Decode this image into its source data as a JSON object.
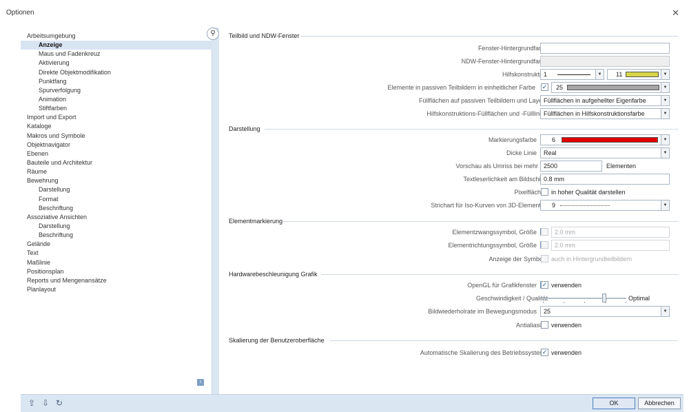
{
  "window": {
    "title": "Optionen"
  },
  "sidebar": {
    "items": [
      {
        "label": "Arbeitsumgebung",
        "level": 1
      },
      {
        "label": "Anzeige",
        "level": 2,
        "selected": true
      },
      {
        "label": "Maus und Fadenkreuz",
        "level": 2
      },
      {
        "label": "Aktivierung",
        "level": 2
      },
      {
        "label": "Direkte Objektmodifikation",
        "level": 2
      },
      {
        "label": "Punktfang",
        "level": 2
      },
      {
        "label": "Spurverfolgung",
        "level": 2
      },
      {
        "label": "Animation",
        "level": 2
      },
      {
        "label": "Stiftfarben",
        "level": 2
      },
      {
        "label": "Import und Export",
        "level": 1
      },
      {
        "label": "Kataloge",
        "level": 1
      },
      {
        "label": "Makros und Symbole",
        "level": 1
      },
      {
        "label": "Objektnavigator",
        "level": 1
      },
      {
        "label": "Ebenen",
        "level": 1
      },
      {
        "label": "Bauteile und Architektur",
        "level": 1
      },
      {
        "label": "Räume",
        "level": 1
      },
      {
        "label": "Bewehrung",
        "level": 1
      },
      {
        "label": "Darstellung",
        "level": 2
      },
      {
        "label": "Format",
        "level": 2
      },
      {
        "label": "Beschriftung",
        "level": 2
      },
      {
        "label": "Assoziative Ansichten",
        "level": 1
      },
      {
        "label": "Darstellung",
        "level": 2
      },
      {
        "label": "Beschriftung",
        "level": 2
      },
      {
        "label": "Gelände",
        "level": 1
      },
      {
        "label": "Text",
        "level": 1
      },
      {
        "label": "Maßlinie",
        "level": 1
      },
      {
        "label": "Positionsplan",
        "level": 1
      },
      {
        "label": "Reports und Mengenansätze",
        "level": 1
      },
      {
        "label": "Planlayout",
        "level": 1
      }
    ],
    "info_icon": "i"
  },
  "sections": {
    "teilbild": "Teilbild und NDW-Fenster",
    "darstellung": "Darstellung",
    "elementmarkierung": "Elementmarkierung",
    "hardware": "Hardwarebeschleunigung Grafik",
    "skalierung": "Skalierung der Benutzeroberfläche"
  },
  "teilbild": {
    "fenster_label": "Fenster-Hintergrundfarbe",
    "ndw_label": "NDW-Fenster-Hintergrundfarbe",
    "hilfs_label": "Hilfskonstruktion",
    "hilfs_line": "1",
    "hilfs_color": "11",
    "hilfs_color_hex": "#d7d54a",
    "passive_label": "Elemente in passiven Teilbildern in einheitlicher Farbe",
    "passive_color": "25",
    "passive_color_hex": "#a6a6a6",
    "fuell_label": "Füllflächen auf passiven Teilbildern und Layern",
    "fuell_value": "Füllflächen in aufgehellter Eigenfarbe",
    "hkfuell_label": "Hilfskonstruktions-Füllflächen und -Fülllinien",
    "hkfuell_value": "Füllflächen in Hilfskonstruktionsfarbe"
  },
  "darstellung": {
    "mark_label": "Markierungsfarbe",
    "mark_value": "6",
    "mark_color_hex": "#e00000",
    "dicke_label": "Dicke Linie",
    "dicke_value": "Real",
    "vorschau_label": "Vorschau als Umriss bei mehr als",
    "vorschau_value": "2500",
    "vorschau_unit": "Elementen",
    "text_label": "Textleserlichkeit am Bildschirm",
    "text_value": "0.8 mm",
    "pixel_label": "Pixelflächen",
    "pixel_cb": "in hoher Qualität darstellen",
    "strich_label": "Strichart für Iso-Kurven von 3D-Elementen",
    "strich_value": "9"
  },
  "elementmarkierung": {
    "zwang_label": "Elementzwangssymbol, Größe",
    "zwang_value": "2.0 mm",
    "richtung_label": "Elementrichtungssymbol, Größe",
    "richtung_value": "2.0 mm",
    "anzeige_label": "Anzeige der Symbole",
    "anzeige_cb": "auch in Hintergrundteilbildern"
  },
  "hardware": {
    "opengl_label": "OpenGL für Grafikfenster",
    "opengl_cb": "verwenden",
    "speed_label": "Geschwindigkeit / Qualität",
    "speed_end": "Optimal",
    "rate_label": "Bildwiederholrate im Bewegungsmodus",
    "rate_value": "25",
    "aa_label": "Antialiasing",
    "aa_cb": "verwenden"
  },
  "skalierung": {
    "auto_label": "Automatische Skalierung des Betriebssystems",
    "auto_cb": "verwenden"
  },
  "footer": {
    "ok": "OK",
    "cancel": "Abbrechen"
  },
  "common": {
    "info": "i",
    "check": "✓",
    "arrow": "▼",
    "search": "⚲"
  }
}
